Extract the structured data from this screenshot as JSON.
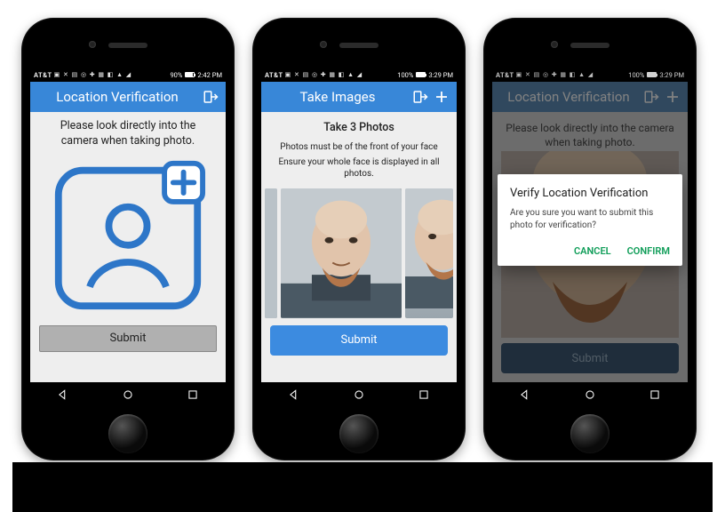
{
  "phone1": {
    "status": {
      "carrier": "AT&T",
      "battery_pct": 90,
      "time": "2:42 PM"
    },
    "appbar": {
      "title": "Location Verification"
    },
    "instruction": "Please look directly into the camera when taking photo.",
    "submit_label": "Submit"
  },
  "phone2": {
    "status": {
      "carrier": "AT&T",
      "battery_pct": 100,
      "time": "3:29 PM"
    },
    "appbar": {
      "title": "Take Images"
    },
    "heading": "Take 3 Photos",
    "line1": "Photos must be of the front of your face",
    "line2": "Ensure your whole face is displayed in all photos.",
    "close_x": "x",
    "submit_label": "Submit"
  },
  "phone3": {
    "status": {
      "carrier": "AT&T",
      "battery_pct": 100,
      "time": "3:29 PM"
    },
    "appbar": {
      "title": "Location Verification"
    },
    "instruction": "Please look directly into the camera when taking photo.",
    "close_x": "X",
    "submit_label": "Submit",
    "dialog": {
      "title": "Verify Location Verification",
      "body": "Are you sure you want to submit  this photo for verification?",
      "cancel": "CANCEL",
      "confirm": "CONFIRM"
    }
  },
  "colors": {
    "brand": "#3887d8",
    "accent": "#0f9d58"
  }
}
